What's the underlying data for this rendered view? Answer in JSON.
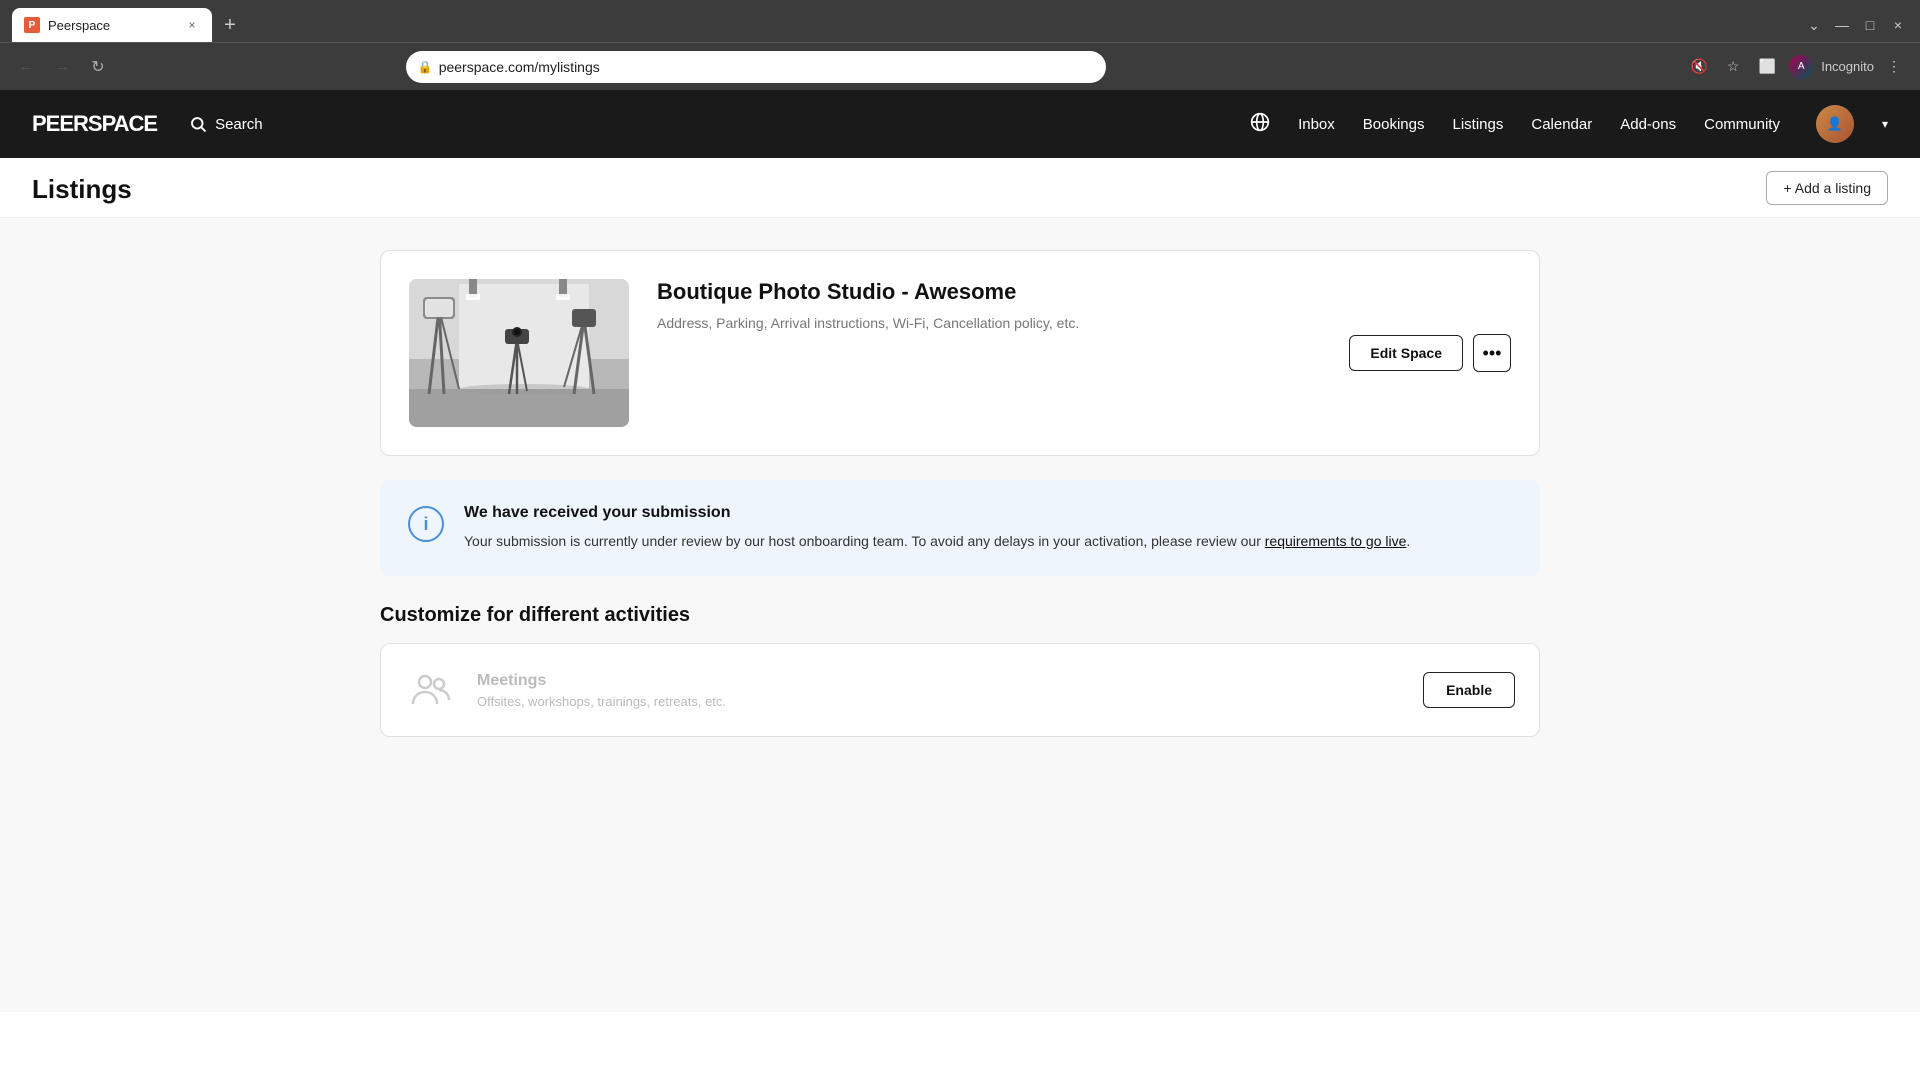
{
  "browser": {
    "tab_favicon": "P",
    "tab_title": "Peerspace",
    "tab_close": "×",
    "new_tab": "+",
    "back": "←",
    "forward": "→",
    "refresh": "↻",
    "url": "peerspace.com/mylistings",
    "lock_icon": "🔒",
    "window_controls": {
      "minimize": "—",
      "maximize": "□",
      "close": "×"
    },
    "extensions": [
      "🔕",
      "☆",
      "⬜"
    ],
    "profile_label": "Incognito",
    "menu": "⋮"
  },
  "nav": {
    "logo": "PEERSPACE",
    "search_label": "Search",
    "globe_icon": "🌐",
    "links": [
      "Inbox",
      "Bookings",
      "Listings",
      "Calendar",
      "Add-ons",
      "Community"
    ],
    "chevron": "▾"
  },
  "page": {
    "title": "Listings",
    "add_listing_btn": "+ Add a listing"
  },
  "listing": {
    "name": "Boutique Photo Studio - Awesome",
    "subtitle": "Address, Parking, Arrival instructions, Wi-Fi, Cancellation policy, etc.",
    "edit_btn": "Edit Space",
    "more_btn": "•••"
  },
  "info_banner": {
    "icon": "i",
    "title": "We have received your submission",
    "text": "Your submission is currently under review by our host onboarding team. To avoid any delays in your activation, please review our",
    "link": "requirements to go live",
    "text_end": "."
  },
  "customize_section": {
    "title": "Customize for different activities",
    "activities": [
      {
        "name": "Meetings",
        "desc": "Offsites, workshops, trainings, retreats, etc.",
        "enable_btn": "Enable"
      }
    ]
  }
}
